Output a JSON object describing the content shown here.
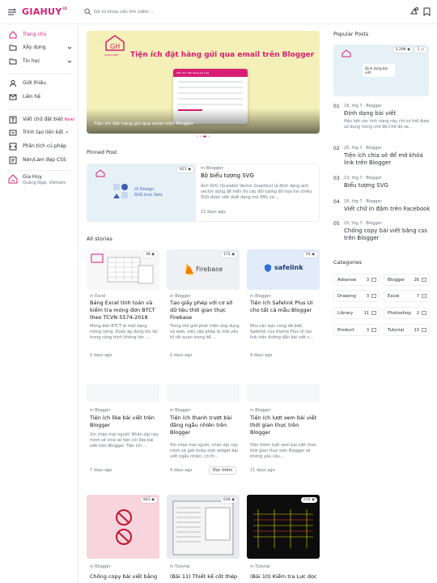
{
  "header": {
    "logo": "GIAHUY",
    "logo_mark": "ID",
    "search_placeholder": "Gõ từ khóa cần tìm kiếm ...",
    "icons": [
      "theme-toggle-icon",
      "bookmark-icon"
    ]
  },
  "sidebar": {
    "items": [
      {
        "label": "Trang chủ",
        "icon": "home-icon",
        "active": true
      },
      {
        "label": "Xây dựng",
        "icon": "folder-icon",
        "chevron": true
      },
      {
        "label": "Tin học",
        "icon": "folder-icon",
        "chevron": true
      },
      {
        "label": "Giới thiệu",
        "icon": "user-icon"
      },
      {
        "label": "Liên hệ",
        "icon": "mail-icon"
      },
      {
        "label": "Viết chữ đặt biệt",
        "icon": "text-icon",
        "badge": "New!"
      },
      {
        "label": "Trình tạo liên kết",
        "icon": "link-icon",
        "ext": "↗"
      },
      {
        "label": "Phân tích cú pháp",
        "icon": "code-icon"
      },
      {
        "label": "Nén/Làm đẹp CSS",
        "icon": "css-icon"
      }
    ],
    "profile": {
      "name": "Gia Huy",
      "location": "Quảng Ngãi, Vietnam"
    }
  },
  "hero": {
    "title": "Tiện ích đặt hàng gửi qua email trên Blogger",
    "caption": "Tiện ích đặt hàng gửi qua email trên Blogger",
    "brand": "GIAHUY.NET",
    "mock_title": "Mẫu đơn đặt hàng gửi mail"
  },
  "pinned": {
    "heading": "Pinned Post",
    "views": "821",
    "category": "in Blogger",
    "title": "Bộ biểu tượng SVG",
    "desc": "Ảnh SVG (Scalable Vector Graphics) là định dạng ảnh vector dùng để hiển thị các đối tượng đồ họa hai chiều. SVG được viết dưới dạng mã XML và ...",
    "date": "11 days ago",
    "thumb_text": "UI Design\nSVG Icon Sets"
  },
  "stories": {
    "heading": "All stories",
    "more_label": "Đọc thêm",
    "cards": [
      {
        "views": "38",
        "category": "in Excel",
        "title": "Bảng Excel tính toán và kiểm tra móng đơn BTCT theo TCVN 5574-2018",
        "desc": "Móng đơn BTCT là một dạng móng nông. Được áp dụng khi tải trọng công trình không lớn ...",
        "date": "2 days ago",
        "thumb": "excel"
      },
      {
        "views": "172",
        "category": "in Blogger",
        "title": "Tạo giấy phép với cơ sở dữ liệu thời gian thực Firebase",
        "desc": "Trong thế giới phát triển ứng dụng và web, việc cấp phép là một yếu tố rất quan trọng để ...",
        "date": "2 days ago",
        "thumb": "firebase",
        "thumb_text": "Firebase"
      },
      {
        "views": "54",
        "category": "in Blogger",
        "title": "Tiện ích Safelink Plus UI cho tất cả mẫu Blogger",
        "desc": "Như các bạn cũng đã biết, Safelink của theme Plus UI tạo link trên đường dẫn bài viết c...",
        "date": "9 days ago",
        "thumb": "safelink",
        "thumb_text": "safelink"
      },
      {
        "views": "",
        "category": "in Blogger",
        "title": "Tiện ích like bài viết trên Blogger",
        "desc": "Xin chào mọi người! Nhân dịp này mình sẽ chia sẻ tiện ích like bài viết trên Blogger. Tiện ích ...",
        "date": "7 days ago",
        "thumb": "blank"
      },
      {
        "views": "",
        "category": "in Blogger",
        "title": "Tiện ích thanh trượt bài đăng ngẫu nhiên trên Blogger",
        "desc": "Xin chào mọi người, nhân dịp này mình sẽ giới thiệu một widget bài viết ngẫu nhiên, có th...",
        "date": "4 days ago",
        "thumb": "blank"
      },
      {
        "views": "",
        "category": "in Blogger",
        "title": "Tiện ích lượt xem bài viết thời gian thực trên Blogger",
        "desc": "Việc thêm lượt xem bài viết theo thời gian thực trên Blogger sẽ không yêu cầu...",
        "date": "11 days ago",
        "thumb": "blank"
      },
      {
        "views": "843",
        "category": "in Blogger",
        "title": "Chống copy bài viết bằng",
        "desc": "",
        "date": "",
        "thumb": "nocopy"
      },
      {
        "views": "618",
        "category": "in Tutorial",
        "title": "(Bài 11) Thiết kế cốt thép",
        "desc": "",
        "date": "",
        "thumb": "cad"
      },
      {
        "views": "214",
        "category": "in Tutorial",
        "title": "(Bài 10) Kiểm tra Lực dọc",
        "desc": "",
        "date": "",
        "thumb": "dark"
      }
    ]
  },
  "popular": {
    "heading": "Popular Posts",
    "views": "3.29K",
    "comments": "1",
    "thumb_text": "Định dạng bài viết",
    "posts": [
      {
        "n": "01",
        "meta": "18, thg 7 · Blogger",
        "title": "Định dạng bài viết",
        "desc": "Hầu hết các tính năng này chỉ có thể được sử dụng trong chế độ Chế độ xe..."
      },
      {
        "n": "02",
        "meta": "20, thg 7 · Blogger",
        "title": "Tiện ích chia sẻ để mở khóa link trên Blogger"
      },
      {
        "n": "03",
        "meta": "13, thg 7 · Blogger",
        "title": "Biểu tượng SVG"
      },
      {
        "n": "04",
        "meta": "16, thg 7 · Blogger",
        "title": "Viết chữ in đậm trên Facebook"
      },
      {
        "n": "05",
        "meta": "15, thg 7 · Blogger",
        "title": "Chống copy bài viết bằng css trên Blogger"
      }
    ]
  },
  "categories": {
    "heading": "Categories",
    "items": [
      {
        "label": "Adsense",
        "count": "3"
      },
      {
        "label": "Blogger",
        "count": "26"
      },
      {
        "label": "Drawing",
        "count": "3"
      },
      {
        "label": "Excel",
        "count": "7"
      },
      {
        "label": "Library",
        "count": "11"
      },
      {
        "label": "Photoshop",
        "count": "2"
      },
      {
        "label": "Product",
        "count": "3"
      },
      {
        "label": "Tutorial",
        "count": "13"
      }
    ]
  },
  "colors": {
    "accent": "#d81d74",
    "hero_bg": "#f4f0b8",
    "muted": "#6b7280"
  }
}
